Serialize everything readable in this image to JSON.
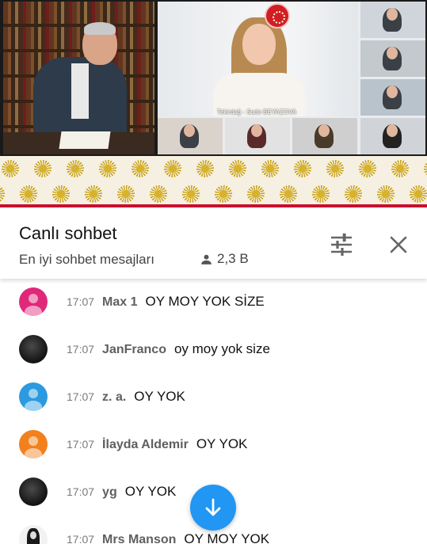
{
  "video": {
    "main_caption": "Tekirdağ - Sude BEYAZOVA",
    "tile_captions": [
      "",
      "",
      "",
      "",
      "",
      "",
      "",
      ""
    ]
  },
  "chat": {
    "title": "Canlı sohbet",
    "mode": "En iyi sohbet mesajları",
    "viewers": "2,3 B",
    "icons": {
      "filter": "tune-icon",
      "close": "close-icon",
      "viewers": "person-icon",
      "scroll": "arrow-down-icon"
    },
    "messages": [
      {
        "time": "17:07",
        "author": "Max 1",
        "text": "OY MOY YOK SİZE",
        "avatar": "pink-default"
      },
      {
        "time": "17:07",
        "author": "JanFranco",
        "text": "oy moy yok size",
        "avatar": "dark-photo"
      },
      {
        "time": "17:07",
        "author": "z. a.",
        "text": "OY YOK",
        "avatar": "blue-default"
      },
      {
        "time": "17:07",
        "author": "İlayda Aldemir",
        "text": "OY YOK",
        "avatar": "orange-default"
      },
      {
        "time": "17:07",
        "author": "yg",
        "text": "OY YOK",
        "avatar": "dark-photo"
      },
      {
        "time": "17:07",
        "author": "Mrs Manson",
        "text": "OY MOY YOK",
        "avatar": "character-photo"
      }
    ]
  },
  "colors": {
    "accent": "#2196f3",
    "band_red": "#c8102e",
    "band_gold": "#c9a31a"
  }
}
